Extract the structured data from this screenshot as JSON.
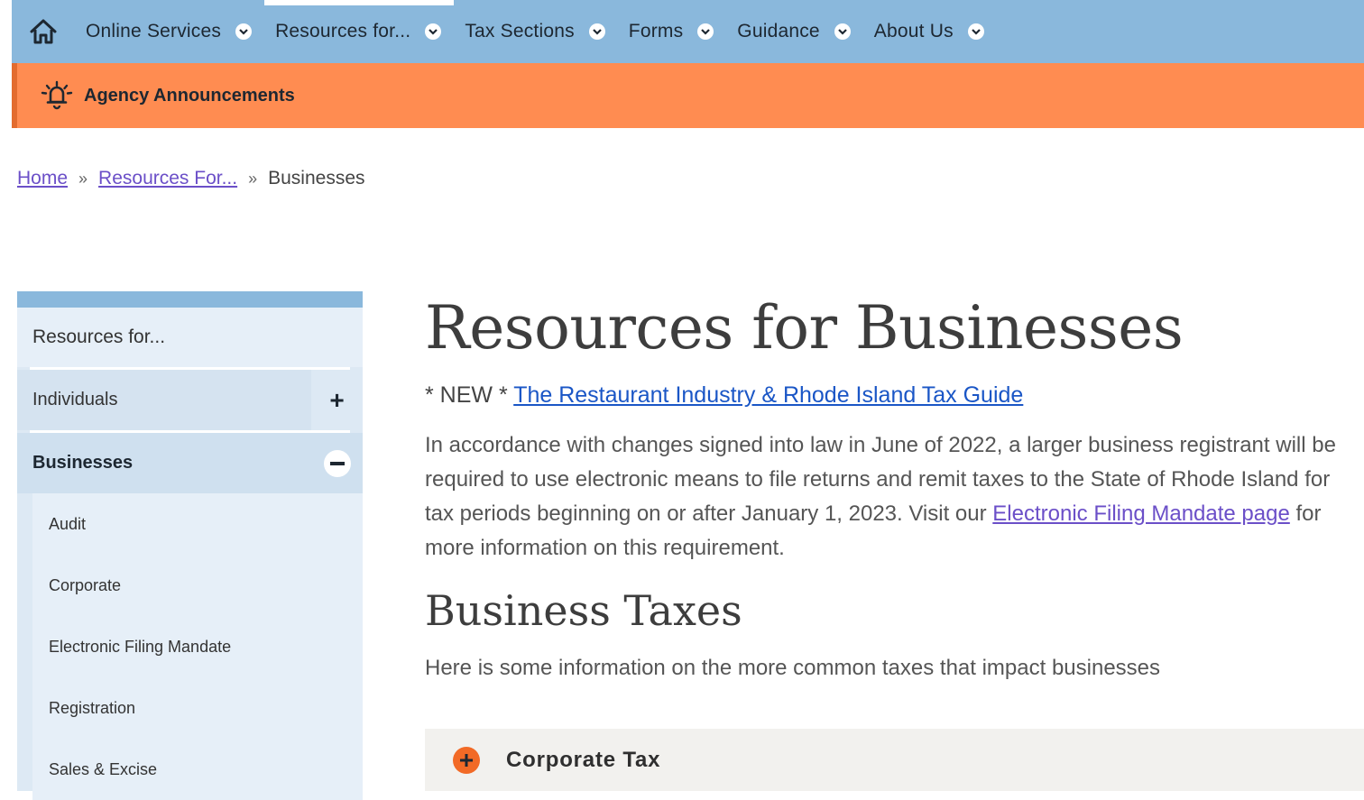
{
  "nav": {
    "items": [
      {
        "label": "Online Services"
      },
      {
        "label": "Resources for..."
      },
      {
        "label": "Tax Sections"
      },
      {
        "label": "Forms"
      },
      {
        "label": "Guidance"
      },
      {
        "label": "About Us"
      }
    ],
    "home_icon": "home-icon",
    "chevron_icon": "chevron-down-icon"
  },
  "announcement": {
    "label": "Agency Announcements",
    "icon": "bell-icon"
  },
  "breadcrumb": {
    "home": "Home",
    "resources": "Resources For...",
    "current": "Businesses",
    "separator": "»"
  },
  "sidebar": {
    "title": "Resources for...",
    "individuals": "Individuals",
    "businesses": "Businesses",
    "sub_items": [
      "Audit",
      "Corporate",
      "Electronic Filing Mandate",
      "Registration",
      "Sales & Excise"
    ]
  },
  "main": {
    "title": "Resources for Businesses",
    "new_prefix": "* NEW *",
    "new_link": "The Restaurant Industry & Rhode Island Tax Guide",
    "para_text": "In accordance with changes signed into law in June of 2022, a larger business registrant will be required to use electronic means to file returns and remit taxes to the State of Rhode Island for tax periods beginning on or after January 1, 2023. Visit our",
    "para_link": "Electronic Filing Mandate page",
    "para_end": "for more information on this requirement.",
    "section_title": "Business Taxes",
    "section_intro": "Here is some information on the more common taxes that impact businesses",
    "accordion_label": "Corporate Tax"
  },
  "colors": {
    "nav": "#8ab8dc",
    "announce": "#ff8c51",
    "accent": "#f26a26",
    "link": "#1a56c6"
  }
}
